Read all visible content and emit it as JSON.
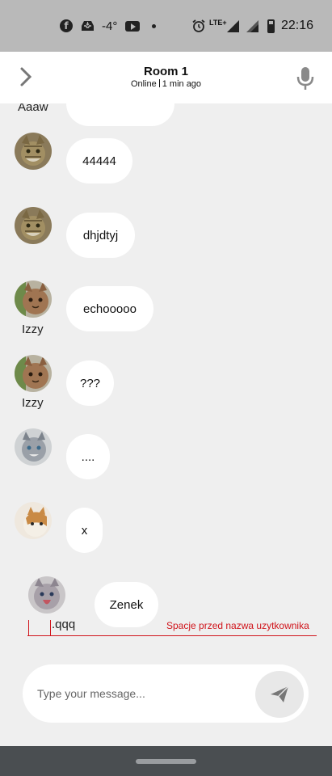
{
  "status_bar": {
    "temperature": "-4°",
    "network": "LTE+",
    "time": "22:16",
    "icons": [
      "facebook-icon",
      "tray-icon",
      "youtube-icon",
      "notification-dot-icon",
      "alarm-icon",
      "signal-icon",
      "signal-icon",
      "battery-icon"
    ]
  },
  "header": {
    "title": "Room 1",
    "online": "Online",
    "last_seen": "1 min ago",
    "back_icon": "chevron-right-icon",
    "mic_icon": "microphone-icon"
  },
  "messages": [
    {
      "username": "Aaaw",
      "text": ""
    },
    {
      "username": "",
      "text": "44444"
    },
    {
      "username": "",
      "text": "dhjdtyj"
    },
    {
      "username": "Izzy",
      "text": "echooooo"
    },
    {
      "username": "Izzy",
      "text": "???"
    },
    {
      "username": "",
      "text": "...."
    },
    {
      "username": "",
      "text": "x"
    },
    {
      "username": ".qqq",
      "text": "Zenek"
    }
  ],
  "annotation": {
    "text": "Spacje przed nazwa uzytkownika",
    "color": "#d0141b"
  },
  "composer": {
    "placeholder": "Type your message...",
    "value": "",
    "send_icon": "send-icon"
  },
  "colors": {
    "background": "#efefef",
    "bubble": "#ffffff",
    "status_bar": "#b9b9b9",
    "nav_bar": "#4a4e51"
  }
}
